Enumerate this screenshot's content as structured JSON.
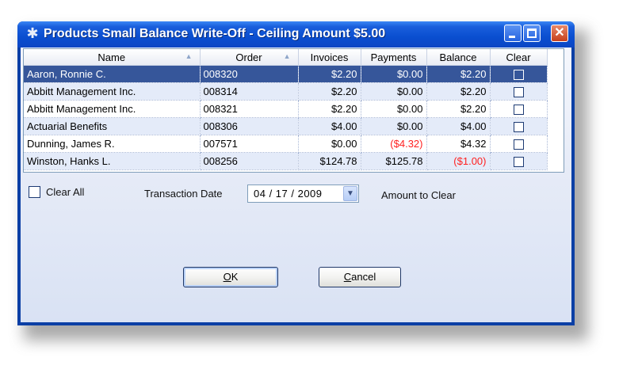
{
  "window": {
    "title": "Products Small Balance Write-Off - Ceiling Amount $5.00",
    "icon": "gear-icon",
    "controls": {
      "minimize": "minimize-icon",
      "maximize": "maximize-icon",
      "close": "✕"
    }
  },
  "grid": {
    "columns": [
      "Name",
      "Order",
      "Invoices",
      "Payments",
      "Balance",
      "Clear"
    ],
    "sort_indicator": "▲",
    "rows": [
      {
        "name": "Aaron, Ronnie C.",
        "order": "008320",
        "invoices": "$2.20",
        "payments": "$0.00",
        "balance": "$2.20",
        "clear": false,
        "selected": true
      },
      {
        "name": "Abbitt Management Inc.",
        "order": "008314",
        "invoices": "$2.20",
        "payments": "$0.00",
        "balance": "$2.20",
        "clear": false
      },
      {
        "name": "Abbitt Management Inc.",
        "order": "008321",
        "invoices": "$2.20",
        "payments": "$0.00",
        "balance": "$2.20",
        "clear": false
      },
      {
        "name": "Actuarial Benefits",
        "order": "008306",
        "invoices": "$4.00",
        "payments": "$0.00",
        "balance": "$4.00",
        "clear": false
      },
      {
        "name": "Dunning, James R.",
        "order": "007571",
        "invoices": "$0.00",
        "payments": "($4.32)",
        "balance": "$4.32",
        "clear": false
      },
      {
        "name": "Winston, Hanks L.",
        "order": "008256",
        "invoices": "$124.78",
        "payments": "$125.78",
        "balance": "($1.00)",
        "clear": false
      }
    ],
    "negative_color": "#ff2020",
    "selection_color": "#36569a"
  },
  "controls": {
    "clear_all_label": "Clear All",
    "clear_all_checked": false,
    "transaction_date_label": "Transaction Date",
    "transaction_date_value": "04 / 17 / 2009",
    "amount_to_clear_label": "Amount to Clear"
  },
  "buttons": {
    "ok_label": "OK",
    "ok_mnemonic": "O",
    "ok_rest": "K",
    "cancel_label": "Cancel",
    "cancel_mnemonic": "C",
    "cancel_rest": "ancel"
  },
  "colors": {
    "titlebar": "#0a4ed0",
    "client_background": "#e6ebf7"
  }
}
